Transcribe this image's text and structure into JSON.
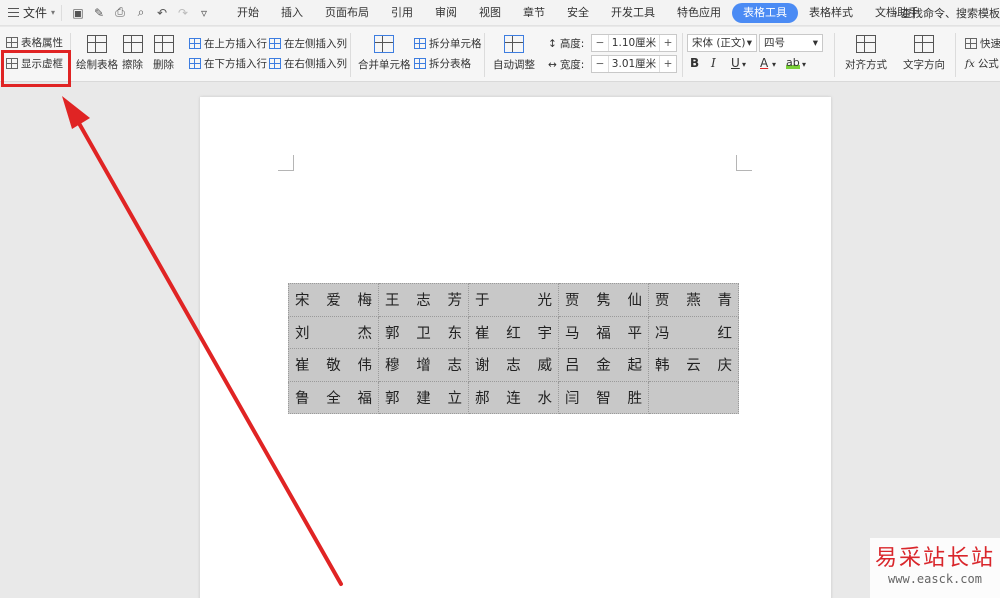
{
  "menubar": {
    "file_label": "文件",
    "tabs": [
      {
        "label": "开始",
        "active": false
      },
      {
        "label": "插入",
        "active": false
      },
      {
        "label": "页面布局",
        "active": false
      },
      {
        "label": "引用",
        "active": false
      },
      {
        "label": "审阅",
        "active": false
      },
      {
        "label": "视图",
        "active": false
      },
      {
        "label": "章节",
        "active": false
      },
      {
        "label": "安全",
        "active": false
      },
      {
        "label": "开发工具",
        "active": false
      },
      {
        "label": "特色应用",
        "active": false
      },
      {
        "label": "表格工具",
        "active": true
      },
      {
        "label": "表格样式",
        "active": false
      },
      {
        "label": "文档助手",
        "active": false
      }
    ],
    "search_label": "查找命令、搜索模板"
  },
  "ribbon": {
    "table_props": "表格属性",
    "show_gridlines": "显示虚框",
    "draw_table": "绘制表格",
    "erase": "擦除",
    "delete": "删除",
    "insert_above": "在上方插入行",
    "insert_below": "在下方插入行",
    "insert_left": "在左侧插入列",
    "insert_right": "在右侧插入列",
    "merge_cells": "合并单元格",
    "split_cells": "拆分单元格",
    "split_table": "拆分表格",
    "auto_fit": "自动调整",
    "height_label": "高度:",
    "height_value": "1.10厘米",
    "width_label": "宽度:",
    "width_value": "3.01厘米",
    "font_name": "宋体 (正文)",
    "font_size": "四号",
    "align": "对齐方式",
    "text_dir": "文字方向",
    "quick_calc": "快速",
    "formula": "公式"
  },
  "document": {
    "table_rows": [
      [
        "宋 爱 梅",
        "王 志 芳",
        "于 光",
        "贾 隽 仙",
        "贾 燕 青"
      ],
      [
        "刘 杰",
        "郭 卫 东",
        "崔 红 宇",
        "马 福 平",
        "冯 红"
      ],
      [
        "崔 敬 伟",
        "穆 增 志",
        "谢 志 威",
        "吕 金 起",
        "韩 云 庆"
      ],
      [
        "鲁 全 福",
        "郭 建 立",
        "郝 连 水",
        "闫 智 胜",
        ""
      ]
    ]
  },
  "watermark": {
    "title": "易采站长站",
    "url": "www.easck.com"
  },
  "colors": {
    "accent": "#4b8bf4",
    "highlight": "#e02424"
  }
}
